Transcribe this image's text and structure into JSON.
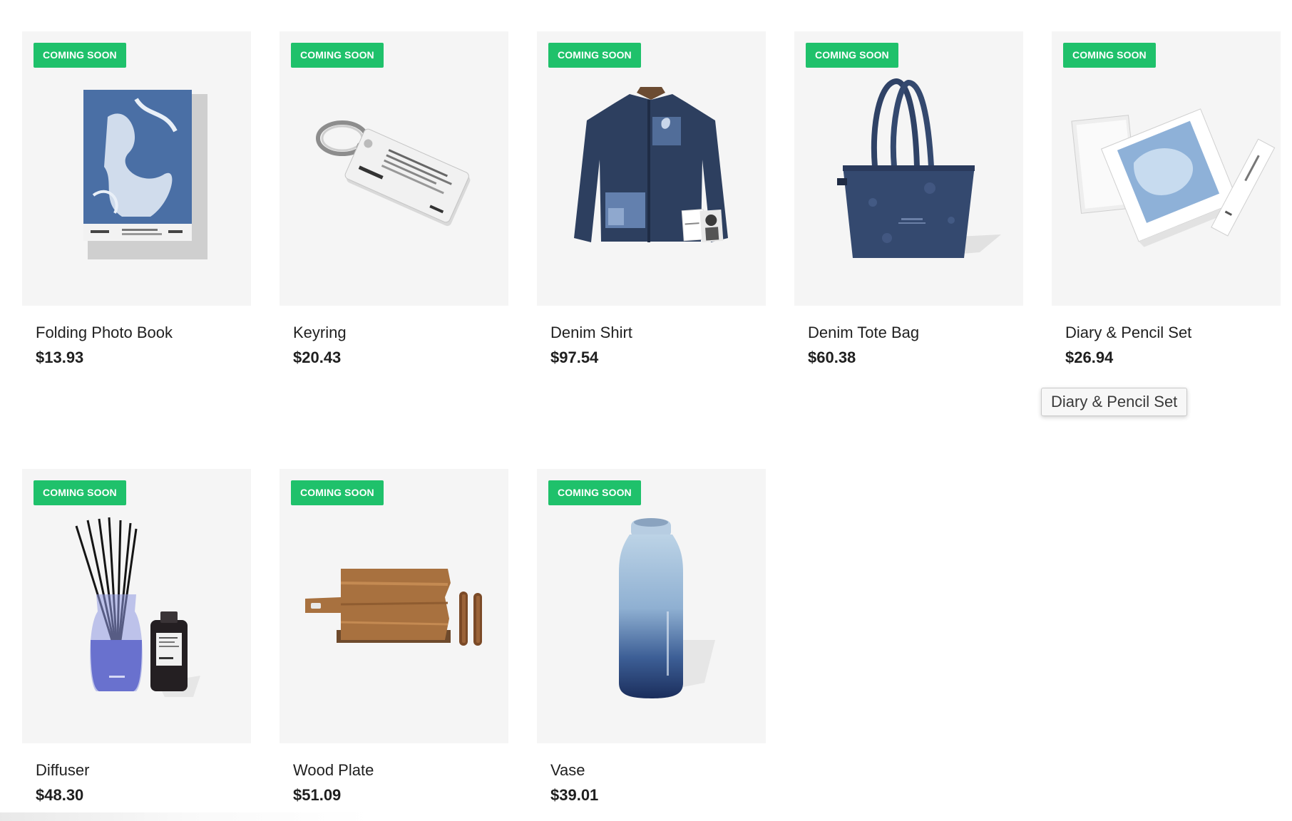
{
  "theme": {
    "badge_color": "#1fc16b",
    "card_bg": "#f5f5f5",
    "text_color": "#1f1f1f"
  },
  "products": [
    {
      "badge": "COMING SOON",
      "title": "Folding Photo Book",
      "price": "$13.93",
      "image": "photo-book"
    },
    {
      "badge": "COMING SOON",
      "title": "Keyring",
      "price": "$20.43",
      "image": "keyring"
    },
    {
      "badge": "COMING SOON",
      "title": "Denim Shirt",
      "price": "$97.54",
      "image": "denim-shirt"
    },
    {
      "badge": "COMING SOON",
      "title": "Denim Tote Bag",
      "price": "$60.38",
      "image": "tote-bag"
    },
    {
      "badge": "COMING SOON",
      "title": "Diary & Pencil Set",
      "price": "$26.94",
      "image": "diary-pencil-set"
    },
    {
      "badge": "COMING SOON",
      "title": "Diffuser",
      "price": "$48.30",
      "image": "diffuser"
    },
    {
      "badge": "COMING SOON",
      "title": "Wood Plate",
      "price": "$51.09",
      "image": "wood-plate"
    },
    {
      "badge": "COMING SOON",
      "title": "Vase",
      "price": "$39.01",
      "image": "vase"
    }
  ],
  "tooltip": {
    "text": "Diary & Pencil Set"
  }
}
